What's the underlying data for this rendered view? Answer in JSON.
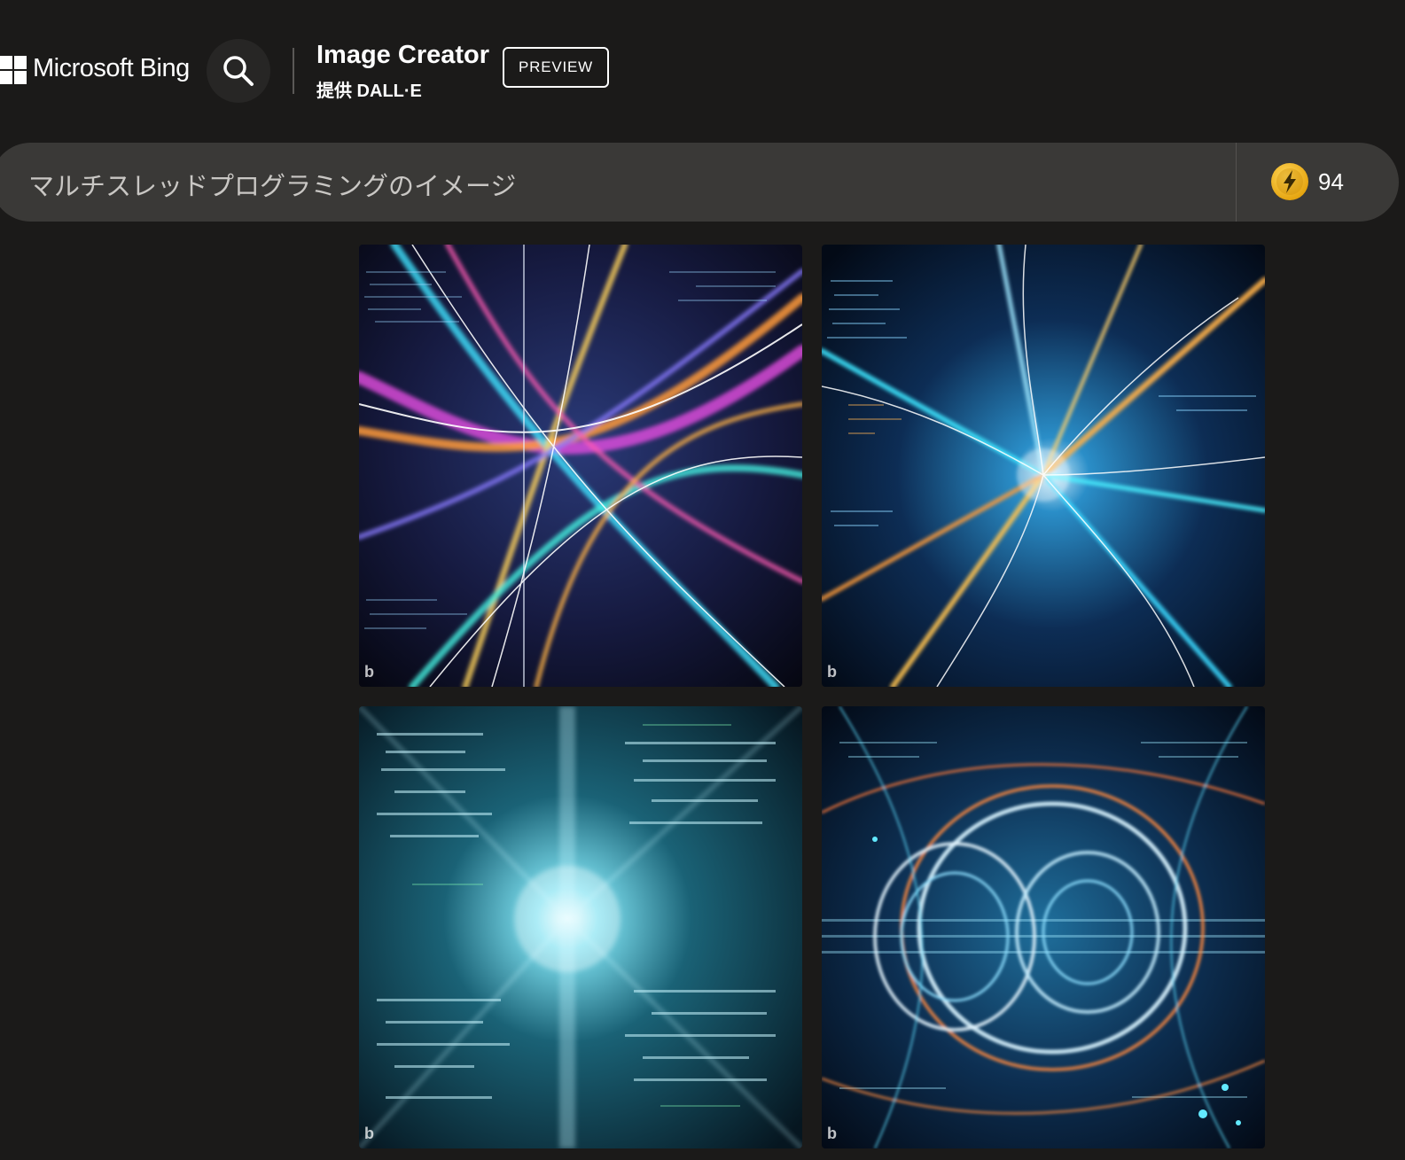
{
  "header": {
    "brand": "Microsoft Bing",
    "title": "Image Creator",
    "subtitle": "提供 DALL·E",
    "badge": "PREVIEW"
  },
  "prompt": {
    "text": "マルチスレッドプログラミングのイメージ",
    "boosts": "94"
  },
  "gallery": {
    "watermark": "b"
  },
  "colors": {
    "background": "#1b1a19",
    "prompt_bar": "#3a3937",
    "coin": "#f2b71f"
  }
}
